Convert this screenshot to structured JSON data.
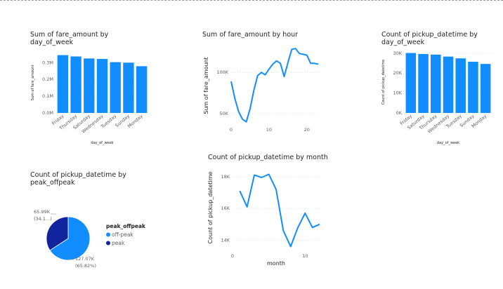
{
  "colors": {
    "primary": "#118DFF",
    "secondary": "#12239E",
    "grid": "#e6e6e6"
  },
  "visuals": [
    {
      "title": "Sum of fare_amount by\nday_of_week",
      "chart_data": {
        "type": "bar",
        "title": "Sum of fare_amount by day_of_week",
        "xlabel": "day_of_week",
        "ylabel": "Sum of fare_amount",
        "categories": [
          "Friday",
          "Thursday",
          "Saturday",
          "Wednesday",
          "Tuesday",
          "Sunday",
          "Monday"
        ],
        "values": [
          0.345,
          0.337,
          0.325,
          0.322,
          0.303,
          0.3,
          0.279
        ],
        "yticks": [
          "0.0M",
          "0.1M",
          "0.2M",
          "0.3M"
        ],
        "ylim": [
          0,
          0.36
        ],
        "grid": true
      }
    },
    {
      "title": "Sum of fare_amount by hour",
      "chart_data": {
        "type": "line",
        "title": "Sum of fare_amount by hour",
        "xlabel": "hour",
        "ylabel": "Sum of fare_amount",
        "x": [
          0,
          1,
          2,
          3,
          4,
          5,
          6,
          7,
          8,
          9,
          10,
          11,
          12,
          13,
          14,
          15,
          16,
          17,
          18,
          19,
          20,
          21,
          22,
          23
        ],
        "y": [
          89000,
          68000,
          52000,
          43000,
          40000,
          56000,
          78000,
          96000,
          100000,
          97000,
          104000,
          110000,
          114000,
          111000,
          95000,
          112000,
          128000,
          129000,
          123000,
          122000,
          121000,
          111000,
          111000,
          110000
        ],
        "xticks": [
          "0",
          "10",
          "20"
        ],
        "yticks": [
          "50K",
          "100K"
        ],
        "xlim": [
          0,
          23
        ],
        "ylim": [
          38000,
          130000
        ],
        "grid": true
      }
    },
    {
      "title": "Count of pickup_datetime by\nday_of_week",
      "chart_data": {
        "type": "bar",
        "title": "Count of pickup_datetime by day_of_week",
        "xlabel": "day_of_week",
        "ylabel": "Count of pickup_datetime",
        "categories": [
          "Friday",
          "Saturday",
          "Thursday",
          "Wednesday",
          "Tuesday",
          "Sunday",
          "Monday"
        ],
        "values": [
          30100,
          29600,
          29300,
          28300,
          27400,
          25700,
          24600
        ],
        "yticks": [
          "0K",
          "10K",
          "20K",
          "30K"
        ],
        "ylim": [
          0,
          31000
        ],
        "grid": true
      }
    },
    {
      "title": "Count of pickup_datetime by\npeak_offpeak",
      "chart_data": {
        "type": "pie",
        "title": "Count of pickup_datetime by peak_offpeak",
        "categories": [
          "off-peak",
          "peak"
        ],
        "values": [
          127070,
          65990
        ],
        "labels": [
          {
            "value": "127.07K",
            "pct": "(65.82%)"
          },
          {
            "value": "65.99K",
            "pct": "(34.1...)"
          }
        ],
        "legend_title": "peak_offpeak",
        "legend_position": "right"
      }
    },
    {
      "title": "Count of pickup_datetime by month",
      "chart_data": {
        "type": "line",
        "title": "Count of pickup_datetime by month",
        "xlabel": "month",
        "ylabel": "Count of pickup_datetime",
        "x": [
          1,
          2,
          3,
          4,
          5,
          6,
          7,
          8,
          9,
          10,
          11,
          12
        ],
        "y": [
          17100,
          16100,
          18100,
          17950,
          18150,
          17200,
          14600,
          13600,
          14800,
          15700,
          14800,
          15000
        ],
        "xticks": [
          "0",
          "10"
        ],
        "yticks": [
          "14K",
          "16K",
          "18K"
        ],
        "xlim": [
          0,
          12
        ],
        "ylim": [
          13400,
          18700
        ],
        "grid": true
      }
    }
  ]
}
